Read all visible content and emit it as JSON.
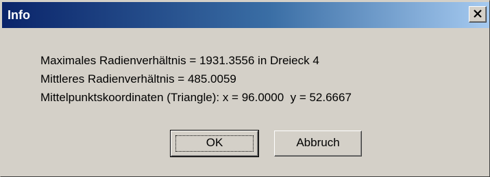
{
  "window": {
    "title": "Info",
    "close_icon": "close-icon"
  },
  "message": {
    "line1": "Maximales Radienverhältnis = 1931.3556 in Dreieck 4",
    "line2": "Mittleres Radienverhältnis = 485.0059",
    "line3": "Mittelpunktskoordinaten (Triangle): x = 96.0000  y = 52.6667"
  },
  "buttons": {
    "ok_label": "OK",
    "cancel_label": "Abbruch"
  },
  "colors": {
    "dialog_face": "#d4d0c8",
    "title_start": "#0a246a",
    "title_end": "#a6caf0"
  }
}
